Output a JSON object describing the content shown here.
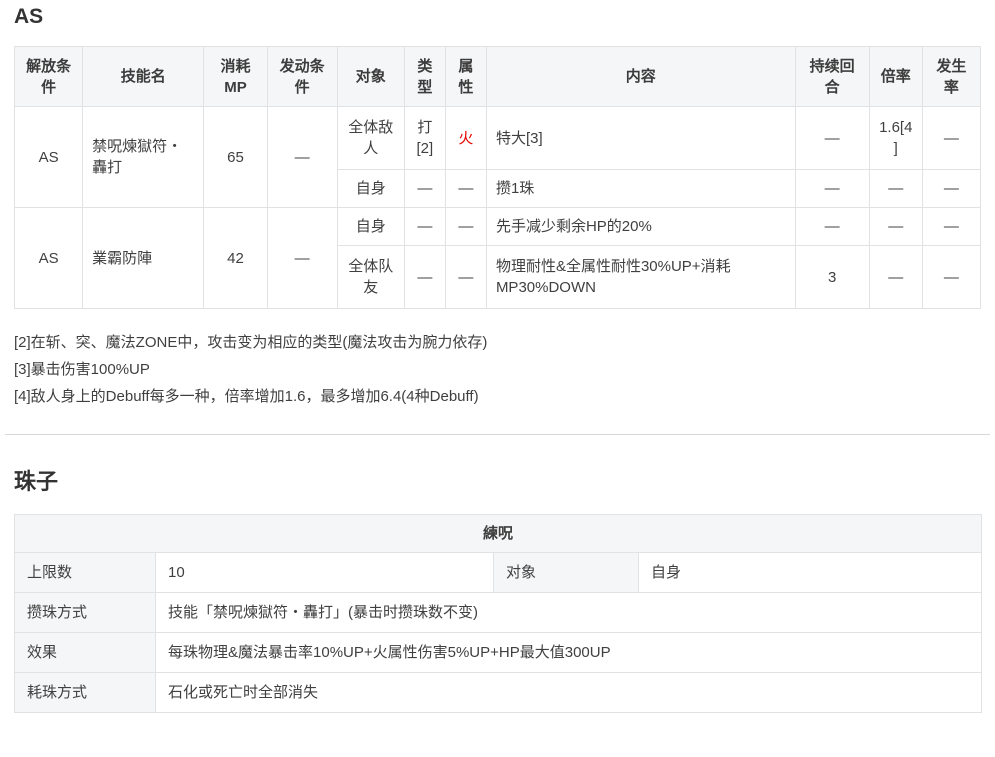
{
  "colors": {
    "fire_red": "#e60000",
    "header_bg": "#f5f6f7",
    "border": "#e0e2e4",
    "text": "#404040"
  },
  "as_section": {
    "title": "AS",
    "headers": [
      "解放条件",
      "技能名",
      "消耗MP",
      "发动条件",
      "对象",
      "类型",
      "属性",
      "内容",
      "持续回合",
      "倍率",
      "发生率"
    ],
    "skills": [
      {
        "unlock": "AS",
        "name": "禁呪煉獄符・轟打",
        "mp": "65",
        "trigger": "—",
        "effects": [
          {
            "target": "全体敌人",
            "type": "打[2]",
            "element": "火",
            "content": "特大[3]",
            "duration": "—",
            "multiplier": "1.6[4]",
            "rate": "—"
          },
          {
            "target": "自身",
            "type": "—",
            "element": "—",
            "content": "攒1珠",
            "duration": "—",
            "multiplier": "—",
            "rate": "—"
          }
        ]
      },
      {
        "unlock": "AS",
        "name": "業霸防陣",
        "mp": "42",
        "trigger": "—",
        "effects": [
          {
            "target": "自身",
            "type": "—",
            "element": "—",
            "content": "先手减少剩余HP的20%",
            "duration": "—",
            "multiplier": "—",
            "rate": "—"
          },
          {
            "target": "全体队友",
            "type": "—",
            "element": "—",
            "content": "物理耐性&全属性耐性30%UP+消耗MP30%DOWN",
            "duration": "3",
            "multiplier": "—",
            "rate": "—"
          }
        ]
      }
    ],
    "footnotes": [
      "[2]在斩、突、魔法ZONE中，攻击变为相应的类型(魔法攻击为腕力依存)",
      "[3]暴击伤害100%UP",
      "[4]敌人身上的Debuff每多一种，倍率增加1.6，最多增加6.4(4种Debuff)"
    ]
  },
  "beads_section": {
    "title": "珠子",
    "table_title": "練呪",
    "rows": [
      {
        "label": "上限数",
        "value": "10",
        "label2": "对象",
        "value2": "自身"
      },
      {
        "label": "攒珠方式",
        "value": "技能「禁呪煉獄符・轟打」(暴击时攒珠数不变)"
      },
      {
        "label": "效果",
        "value": "每珠物理&魔法暴击率10%UP+火属性伤害5%UP+HP最大值300UP"
      },
      {
        "label": "耗珠方式",
        "value": "石化或死亡时全部消失"
      }
    ]
  }
}
